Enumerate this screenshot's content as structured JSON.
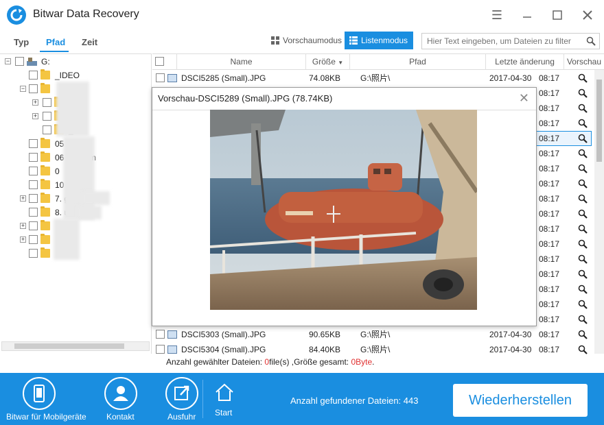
{
  "app": {
    "title": "Bitwar Data Recovery"
  },
  "tabs": [
    {
      "label": "Typ"
    },
    {
      "label": "Pfad"
    },
    {
      "label": "Zeit"
    }
  ],
  "view_modes": {
    "preview": "Vorschaumodus",
    "list": "Listenmodus"
  },
  "search": {
    "placeholder": "Hier Text eingeben, um Dateien zu filter"
  },
  "tree": {
    "root": "G:",
    "items": [
      "_IDEO",
      "",
      "_",
      "",
      "_K",
      "05",
      "06 rity form",
      "0",
      "10",
      "7. g arrangen",
      "8. urs",
      "",
      "",
      ""
    ]
  },
  "columns": {
    "name": "Name",
    "size": "Größe",
    "path": "Pfad",
    "modified": "Letzte änderung",
    "preview": "Vorschau"
  },
  "files": [
    {
      "name": "DSCI5285 (Small).JPG",
      "size": "74.08KB",
      "path": "G:\\照片\\",
      "date": "2017-04-30",
      "time": "08:17"
    },
    {
      "time": "08:17"
    },
    {
      "time": "08:17"
    },
    {
      "time": "08:17"
    },
    {
      "time": "08:17"
    },
    {
      "time": "08:17"
    },
    {
      "time": "08:17"
    },
    {
      "time": "08:17"
    },
    {
      "time": "08:17"
    },
    {
      "time": "08:17"
    },
    {
      "time": "08:17"
    },
    {
      "time": "08:17"
    },
    {
      "time": "08:17"
    },
    {
      "time": "08:17"
    },
    {
      "time": "08:17"
    },
    {
      "time": "08:17"
    },
    {
      "time": "08:17"
    },
    {
      "name": "DSCI5303 (Small).JPG",
      "size": "90.65KB",
      "path": "G:\\照片\\",
      "date": "2017-04-30",
      "time": "08:17"
    },
    {
      "name": "DSCI5304 (Small).JPG",
      "size": "84.40KB",
      "path": "G:\\照片\\",
      "date": "2017-04-30",
      "time": "08:17"
    }
  ],
  "preview_popup": {
    "title": "Vorschau-DSCI5289 (Small).JPG (78.74KB)"
  },
  "status": {
    "prefix": "Anzahl gewählter Dateien: ",
    "count": "0",
    "mid": "file(s) ,Größe gesamt: ",
    "size": "0Byte",
    "suffix": "."
  },
  "bottom": {
    "mobile": "Bitwar für Mobilgeräte",
    "contact": "Kontakt",
    "export": "Ausfuhr",
    "start": "Start",
    "found": "Anzahl gefundener Dateien: 443",
    "restore": "Wiederherstellen"
  },
  "colors": {
    "accent": "#1a8ee0",
    "highlight": "#e03030"
  }
}
